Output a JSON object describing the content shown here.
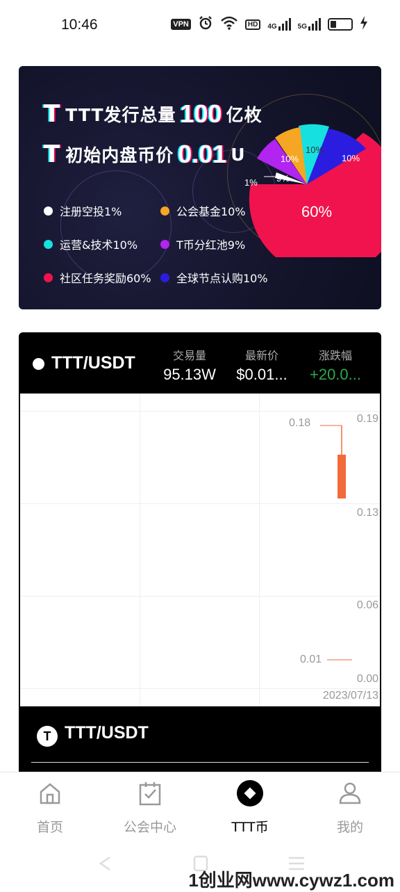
{
  "status_bar": {
    "time": "10:46",
    "vpn": "VPN",
    "hd": "HD",
    "sig1": "4G",
    "sig2": "5G",
    "icons": [
      "alarm-icon",
      "wifi-icon",
      "battery-icon",
      "charging-icon"
    ]
  },
  "banner": {
    "line1_text": "TTT发行总量",
    "line1_big": "100",
    "line1_suffix": "亿枚",
    "line2_text": "初始内盘币价",
    "line2_big": "0.01",
    "line2_suffix": "U",
    "logo_glyph": "T",
    "legend": [
      {
        "label": "注册空投1%",
        "color": "#ffffff"
      },
      {
        "label": "公会基金10%",
        "color": "#f5a623"
      },
      {
        "label": "运营&技术10%",
        "color": "#17e0e0"
      },
      {
        "label": "T币分红池9%",
        "color": "#b224ef"
      },
      {
        "label": "社区任务奖励60%",
        "color": "#f0134d"
      },
      {
        "label": "全球节点认购10%",
        "color": "#2b1de0"
      }
    ],
    "pie_labels": {
      "airdrop": "1%",
      "fund": "10%",
      "ops": "10%",
      "pool": "9%",
      "community": "60%",
      "node": "10%"
    }
  },
  "market": {
    "pair": "TTT/USDT",
    "volume_label": "交易量",
    "volume_value": "95.13W",
    "price_label": "最新价",
    "price_value": "$0.01...",
    "change_label": "涨跌幅",
    "change_value": "+20.0...",
    "change_color": "#2ea84a",
    "footer_pair": "TTT/USDT",
    "footer_logo": "T"
  },
  "chart_data": {
    "type": "candlestick",
    "y_ticks": [
      "0.19",
      "0.13",
      "0.06",
      "0.00"
    ],
    "high_label": "0.18",
    "low_label": "0.01",
    "date_label": "2023/07/13",
    "ylim": [
      0,
      0.19
    ],
    "candles": [
      {
        "date": "2023/07/13",
        "open": 0.16,
        "close": 0.13,
        "high": 0.18,
        "low": 0.13,
        "color": "#f26a3a"
      }
    ]
  },
  "tabbar": {
    "tabs": [
      {
        "label": "首页"
      },
      {
        "label": "公会中心"
      },
      {
        "label": "TTT币"
      },
      {
        "label": "我的"
      }
    ]
  },
  "watermark": "1创业网www.cywz1.com"
}
